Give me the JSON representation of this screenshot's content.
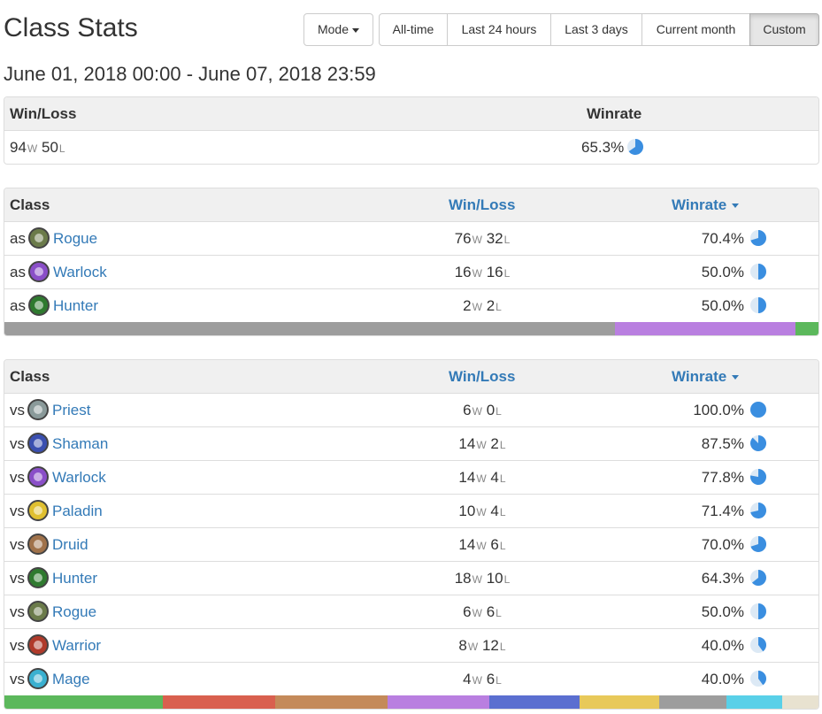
{
  "header": {
    "title": "Class Stats",
    "mode_label": "Mode",
    "ranges": [
      "All-time",
      "Last 24 hours",
      "Last 3 days",
      "Current month",
      "Custom"
    ],
    "active_range": "Custom",
    "date_range": "June 01, 2018 00:00 - June 07, 2018 23:59"
  },
  "summary": {
    "col_winloss": "Win/Loss",
    "col_winrate": "Winrate",
    "wins": "94",
    "losses": "50",
    "win_suffix": "W",
    "loss_suffix": "L",
    "winrate": "65.3%",
    "winrate_value": 65.3
  },
  "as_table": {
    "col_class": "Class",
    "col_winloss": "Win/Loss",
    "col_winrate": "Winrate",
    "rows": [
      {
        "prefix": "as",
        "name": "Rogue",
        "icon": "rogue-icon",
        "icon_color": "#6b7b4a",
        "wins": "76",
        "losses": "32",
        "winrate": "70.4%",
        "rate": 70.4
      },
      {
        "prefix": "as",
        "name": "Warlock",
        "icon": "warlock-icon",
        "icon_color": "#8a4fc8",
        "wins": "16",
        "losses": "16",
        "winrate": "50.0%",
        "rate": 50.0
      },
      {
        "prefix": "as",
        "name": "Hunter",
        "icon": "hunter-icon",
        "icon_color": "#2f7a2f",
        "wins": "2",
        "losses": "2",
        "winrate": "50.0%",
        "rate": 50.0
      }
    ],
    "distribution": [
      {
        "color": "#9d9d9d",
        "share": 0.75
      },
      {
        "color": "#b97fe0",
        "share": 0.222
      },
      {
        "color": "#5cb85c",
        "share": 0.028
      }
    ]
  },
  "vs_table": {
    "col_class": "Class",
    "col_winloss": "Win/Loss",
    "col_winrate": "Winrate",
    "rows": [
      {
        "prefix": "vs",
        "name": "Priest",
        "icon": "priest-icon",
        "icon_color": "#8a9a9a",
        "wins": "6",
        "losses": "0",
        "winrate": "100.0%",
        "rate": 100.0
      },
      {
        "prefix": "vs",
        "name": "Shaman",
        "icon": "shaman-icon",
        "icon_color": "#3a4fb0",
        "wins": "14",
        "losses": "2",
        "winrate": "87.5%",
        "rate": 87.5
      },
      {
        "prefix": "vs",
        "name": "Warlock",
        "icon": "warlock-icon",
        "icon_color": "#8a4fc8",
        "wins": "14",
        "losses": "4",
        "winrate": "77.8%",
        "rate": 77.8
      },
      {
        "prefix": "vs",
        "name": "Paladin",
        "icon": "paladin-icon",
        "icon_color": "#e0c030",
        "wins": "10",
        "losses": "4",
        "winrate": "71.4%",
        "rate": 71.4
      },
      {
        "prefix": "vs",
        "name": "Druid",
        "icon": "druid-icon",
        "icon_color": "#a0724a",
        "wins": "14",
        "losses": "6",
        "winrate": "70.0%",
        "rate": 70.0
      },
      {
        "prefix": "vs",
        "name": "Hunter",
        "icon": "hunter-icon",
        "icon_color": "#2f7a2f",
        "wins": "18",
        "losses": "10",
        "winrate": "64.3%",
        "rate": 64.3
      },
      {
        "prefix": "vs",
        "name": "Rogue",
        "icon": "rogue-icon",
        "icon_color": "#6b7b4a",
        "wins": "6",
        "losses": "6",
        "winrate": "50.0%",
        "rate": 50.0
      },
      {
        "prefix": "vs",
        "name": "Warrior",
        "icon": "warrior-icon",
        "icon_color": "#b03a2a",
        "wins": "8",
        "losses": "12",
        "winrate": "40.0%",
        "rate": 40.0
      },
      {
        "prefix": "vs",
        "name": "Mage",
        "icon": "mage-icon",
        "icon_color": "#3ab0d0",
        "wins": "4",
        "losses": "6",
        "winrate": "40.0%",
        "rate": 40.0
      }
    ],
    "distribution": [
      {
        "color": "#5cb85c",
        "share": 0.195
      },
      {
        "color": "#d9604f",
        "share": 0.138
      },
      {
        "color": "#c48a5a",
        "share": 0.138
      },
      {
        "color": "#b97fe0",
        "share": 0.125
      },
      {
        "color": "#5b6fd0",
        "share": 0.111
      },
      {
        "color": "#e8c95a",
        "share": 0.097
      },
      {
        "color": "#9d9d9d",
        "share": 0.083
      },
      {
        "color": "#59d0e8",
        "share": 0.069
      },
      {
        "color": "#e8e2d0",
        "share": 0.044
      }
    ]
  },
  "colors": {
    "link": "#337ab7",
    "pie_fill": "#3a8ee0",
    "pie_bg": "#dce9f5"
  }
}
